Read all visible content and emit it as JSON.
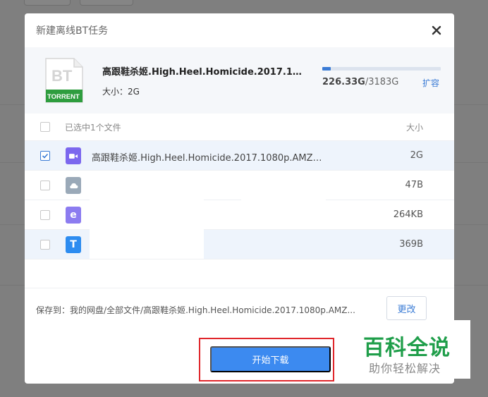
{
  "dialog": {
    "title": "新建离线BT任务",
    "close_icon": "close-icon"
  },
  "torrent": {
    "icon_text_top": "BT",
    "icon_text_bottom": "TORRENT",
    "name": "高跟鞋杀姬.High.Heel.Homicide.2017.108...",
    "size_label": "大小：",
    "size_value": "2G"
  },
  "storage": {
    "used": "226.33G",
    "total": "/3183G",
    "usage_fraction": 0.071,
    "expand_label": "扩容"
  },
  "file_list": {
    "header_label": "已选中1个文件",
    "size_header": "大小",
    "rows": [
      {
        "name": "高跟鞋杀姬.High.Heel.Homicide.2017.1080p.AMZN...",
        "size": "2G",
        "checked": true,
        "icon": "video-file-icon",
        "icon_color": "#7b67ee"
      },
      {
        "name": "",
        "size": "47B",
        "checked": false,
        "icon": "cloud-file-icon",
        "icon_color": "#9aa9b8"
      },
      {
        "name": "",
        "size": "264KB",
        "checked": false,
        "icon": "web-file-icon",
        "icon_color": "#8c7cf0"
      },
      {
        "name": "",
        "size": "369B",
        "checked": false,
        "icon": "text-file-icon",
        "icon_color": "#2d8cf0"
      }
    ]
  },
  "save": {
    "label": "保存到：",
    "path": "我的网盘/全部文件/高跟鞋杀姬.High.Heel.Homicide.2017.1080p.AMZ...",
    "change_label": "更改"
  },
  "actions": {
    "start_label": "开始下载"
  },
  "watermark": {
    "main": "百科全说",
    "sub": "助你轻松解决"
  },
  "colors": {
    "accent": "#3c8af0",
    "highlight": "#e0262b",
    "brand_green": "#1f9e4a"
  }
}
